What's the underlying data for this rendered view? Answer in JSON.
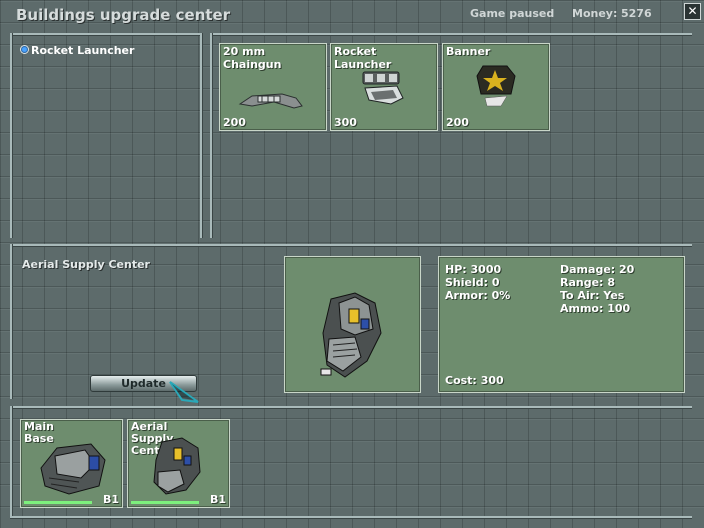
{
  "window": {
    "title": "Buildings upgrade center",
    "status": "Game paused",
    "money_label": "Money:",
    "money_value": "5276",
    "close_icon": "close-icon"
  },
  "colors": {
    "card_green": "#6e8d6e",
    "frame_line": "#a9baba",
    "accent_blue": "#4aa3ff",
    "health_green": "#7df07d"
  },
  "upgrade_list": {
    "items": [
      {
        "label": "Rocket Launcher",
        "selected": true
      }
    ]
  },
  "upgrades": [
    {
      "name": "20 mm Chaingun",
      "cost": "200",
      "icon": "chaingun-icon"
    },
    {
      "name": "Rocket Launcher",
      "cost": "300",
      "icon": "rocket-launcher-icon"
    },
    {
      "name": "Banner",
      "cost": "200",
      "icon": "banner-icon"
    }
  ],
  "details": {
    "building_name": "Aerial Supply Center",
    "preview_icon": "aerial-supply-center-icon",
    "update_label": "Update",
    "stats_left": [
      {
        "label": "HP:",
        "value": "3000"
      },
      {
        "label": "Shield:",
        "value": "0"
      },
      {
        "label": "Armor:",
        "value": "0%"
      }
    ],
    "stats_right": [
      {
        "label": "Damage:",
        "value": "20"
      },
      {
        "label": "Range:",
        "value": "8"
      },
      {
        "label": "To Air:",
        "value": "Yes"
      },
      {
        "label": "Ammo:",
        "value": "100"
      }
    ],
    "cost_label": "Cost:",
    "cost_value": "300"
  },
  "buildings": [
    {
      "name_lines": [
        "Main",
        "Base"
      ],
      "tag": "B1",
      "health": 0.85,
      "icon": "main-base-icon"
    },
    {
      "name_lines": [
        "Aerial",
        "Supply",
        "Center"
      ],
      "tag": "B1",
      "health": 0.85,
      "icon": "aerial-supply-center-icon"
    }
  ]
}
